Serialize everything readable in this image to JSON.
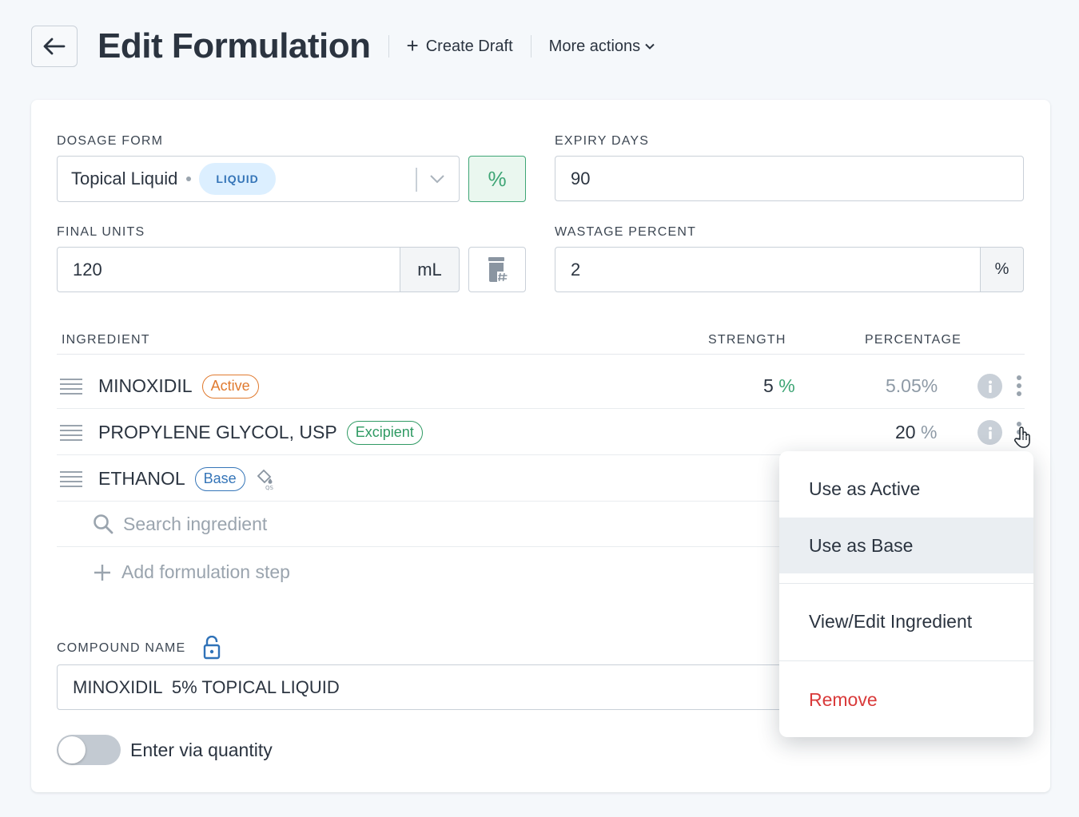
{
  "header": {
    "title": "Edit Formulation",
    "create_draft": "Create Draft",
    "more_actions": "More actions"
  },
  "form": {
    "dosage_form": {
      "label": "DOSAGE FORM",
      "value": "Topical Liquid",
      "badge": "LIQUID",
      "toggle_symbol": "%"
    },
    "expiry_days": {
      "label": "EXPIRY DAYS",
      "value": "90"
    },
    "final_units": {
      "label": "FINAL UNITS",
      "value": "120",
      "unit": "mL"
    },
    "wastage_percent": {
      "label": "WASTAGE PERCENT",
      "value": "2",
      "unit": "%"
    }
  },
  "table": {
    "headers": {
      "ingredient": "INGREDIENT",
      "strength": "STRENGTH",
      "percentage": "PERCENTAGE"
    },
    "rows": [
      {
        "name": "MINOXIDIL",
        "badge": "Active",
        "strength": "5",
        "strength_unit": "%",
        "percentage": "5.05%"
      },
      {
        "name": "PROPYLENE GLYCOL, USP",
        "badge": "Excipient",
        "percentage": "20",
        "percentage_unit": "%"
      },
      {
        "name": "ETHANOL",
        "badge": "Base"
      }
    ],
    "search_placeholder": "Search ingredient",
    "add_step": "Add formulation step"
  },
  "compound": {
    "label": "COMPOUND NAME",
    "value": "MINOXIDIL  5% TOPICAL LIQUID"
  },
  "toggle": {
    "label": "Enter via quantity",
    "on": false
  },
  "menu": {
    "items": [
      "Use as Active",
      "Use as Base",
      "View/Edit Ingredient",
      "Remove"
    ],
    "highlighted": "Use as Base",
    "remove_color": "#d93a3a"
  },
  "colors": {
    "accent_green": "#3ea575",
    "active_orange": "#e07a2f",
    "excipient_green": "#2f9a63",
    "base_blue": "#3575b8"
  }
}
